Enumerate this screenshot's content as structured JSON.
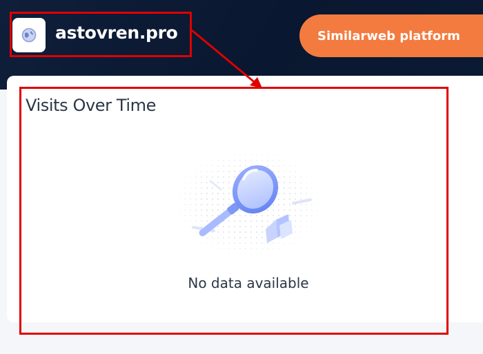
{
  "header": {
    "domain": "astovren.pro",
    "logo_icon": "globe-icon",
    "platform_button_label": "Similarweb platform",
    "accent_color": "#f47b3f",
    "background_color": "#0a1730"
  },
  "card": {
    "title": "Visits Over Time",
    "empty_icon": "magnifier-icon",
    "empty_text": "No data available"
  },
  "annotations": {
    "color": "#e00000"
  }
}
